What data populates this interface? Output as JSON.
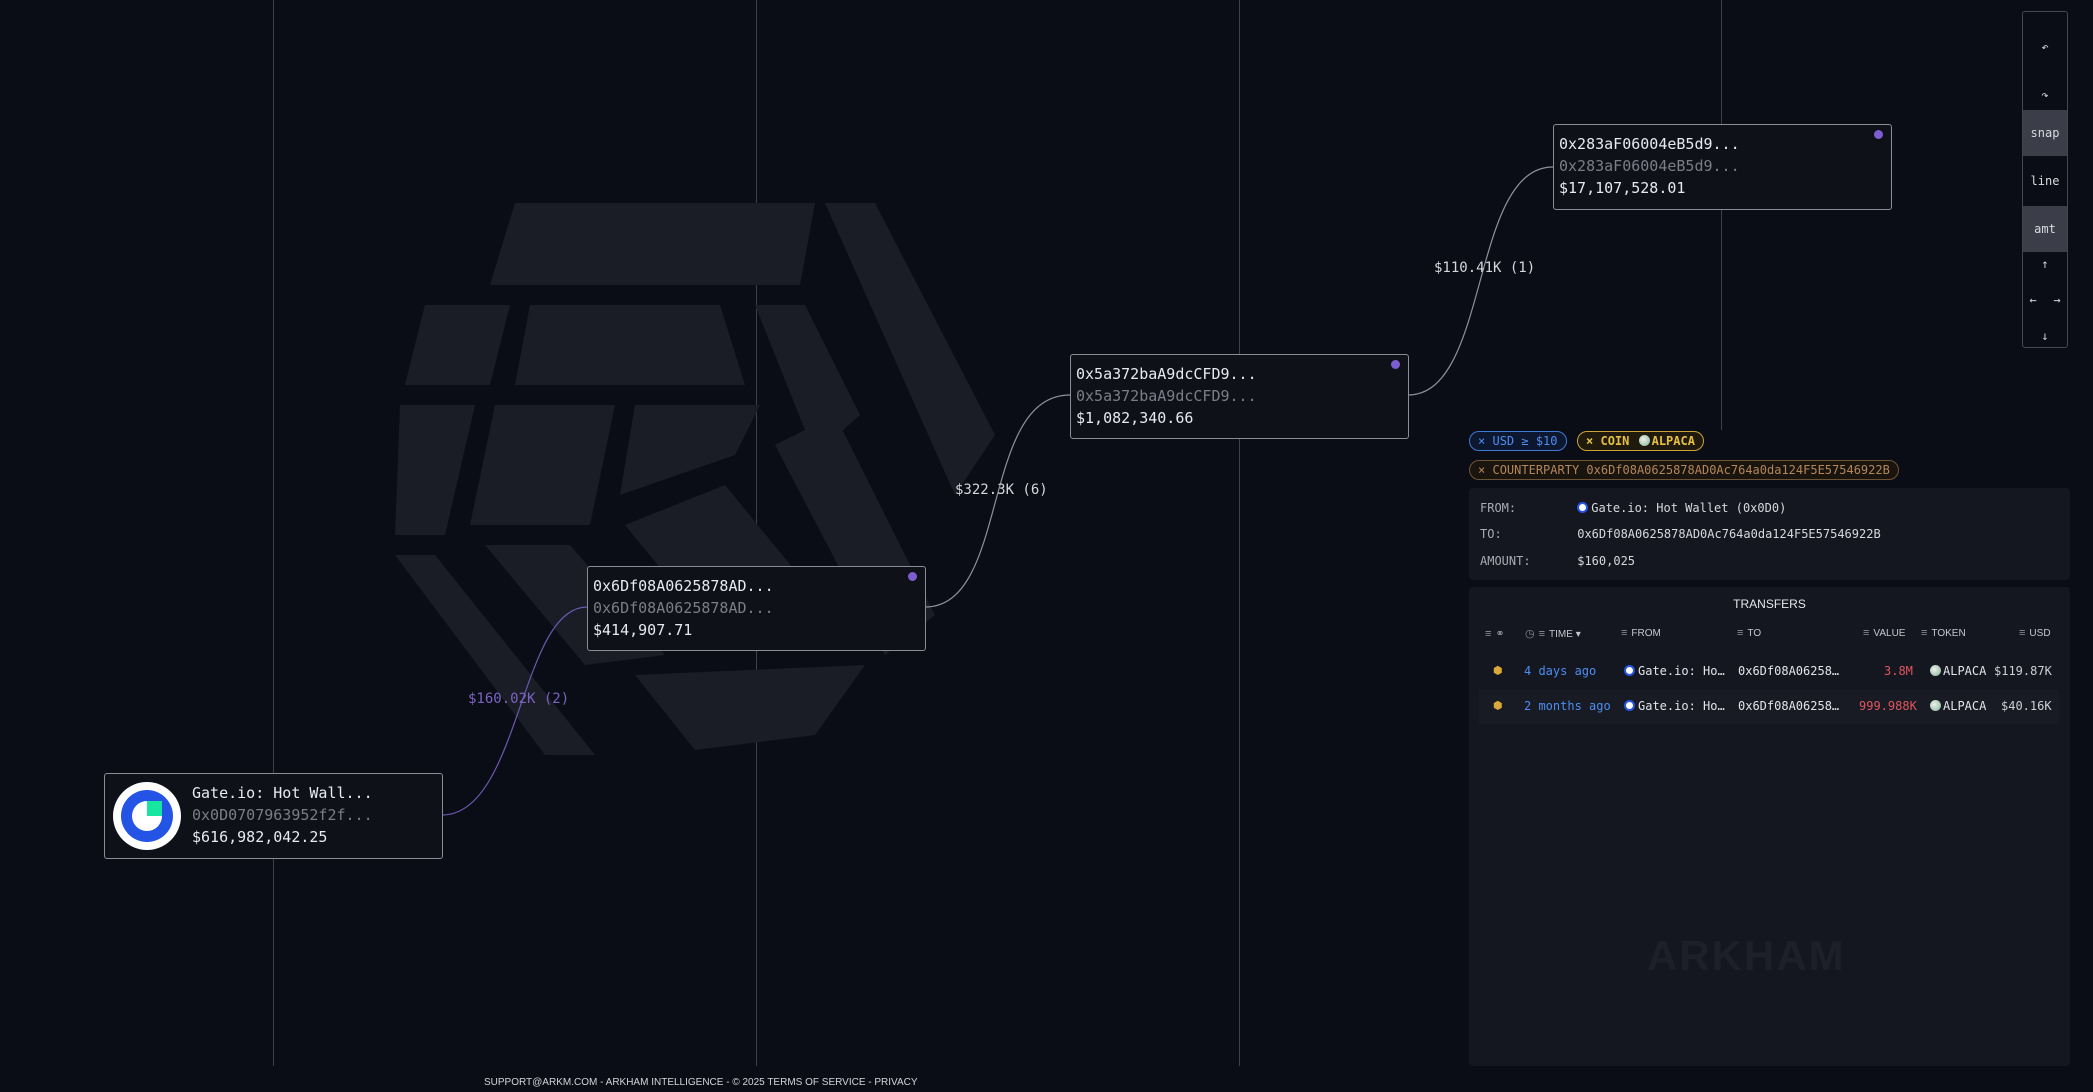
{
  "graph": {
    "nodes": [
      {
        "id": "gate",
        "name": "Gate.io: Hot Wall...",
        "address": "0x0D0707963952f2f...",
        "balance": "$616,982,042.25",
        "logo": "gate-io-logo"
      },
      {
        "id": "n1",
        "name": "0x6Df08A0625878AD...",
        "address": "0x6Df08A0625878AD...",
        "balance": "$414,907.71"
      },
      {
        "id": "n2",
        "name": "0x5a372baA9dcCFD9...",
        "address": "0x5a372baA9dcCFD9...",
        "balance": "$1,082,340.66"
      },
      {
        "id": "n3",
        "name": "0x283aF06004eB5d9...",
        "address": "0x283aF06004eB5d9...",
        "balance": "$17,107,528.01"
      }
    ],
    "edges": [
      {
        "from": "gate",
        "to": "n1",
        "label": "$160.02K (2)",
        "color": "#7a64c2"
      },
      {
        "from": "n1",
        "to": "n2",
        "label": "$322.3K (6)",
        "color": "#9a9ca6"
      },
      {
        "from": "n2",
        "to": "n3",
        "label": "$110.41K (1)",
        "color": "#9a9ca6"
      }
    ]
  },
  "toolbar": {
    "undo_icon": "undo-icon",
    "redo_icon": "redo-icon",
    "undo_glyph": "↶",
    "redo_glyph": "↷",
    "snap": "snap",
    "line": "line",
    "amt": "amt",
    "up": "↑",
    "left": "←",
    "right": "→",
    "down": "↓"
  },
  "filters": {
    "usd_x": "×",
    "usd": "USD ≥ $10",
    "coin_x": "×",
    "coin_label": "COIN",
    "coin_value": "ALPACA",
    "counterparty_x": "×",
    "counterparty": "COUNTERPARTY 0x6Df08A0625878AD0Ac764a0da124F5E57546922B"
  },
  "info": {
    "from_label": "FROM:",
    "from_value": "Gate.io: Hot Wallet (0x0D0)",
    "to_label": "TO:",
    "to_value": "0x6Df08A0625878AD0Ac764a0da124F5E57546922B",
    "amount_label": "AMOUNT:",
    "amount_value": "$160,025"
  },
  "transfers": {
    "title": "TRANSFERS",
    "headers": {
      "time": "TIME",
      "from": "FROM",
      "to": "TO",
      "value": "VALUE",
      "token": "TOKEN",
      "usd": "USD"
    },
    "rows": [
      {
        "time": "4 days ago",
        "from": "Gate.io: Ho…",
        "to": "0x6Df08A06258…",
        "value": "3.8M",
        "token": "ALPACA",
        "usd": "$119.87K"
      },
      {
        "time": "2 months ago",
        "from": "Gate.io: Ho…",
        "to": "0x6Df08A06258…",
        "value": "999.988K",
        "token": "ALPACA",
        "usd": "$40.16K"
      }
    ],
    "watermark": "ARKHAM"
  },
  "footer": "SUPPORT@ARKM.COM - ARKHAM INTELLIGENCE - © 2025  TERMS OF SERVICE - PRIVACY",
  "colors": {
    "background": "#0b0d16",
    "accent_purple": "#7c5ed0",
    "link_blue": "#4d8ef0",
    "value_red": "#e0565e",
    "coin_gold": "#e6c044"
  }
}
